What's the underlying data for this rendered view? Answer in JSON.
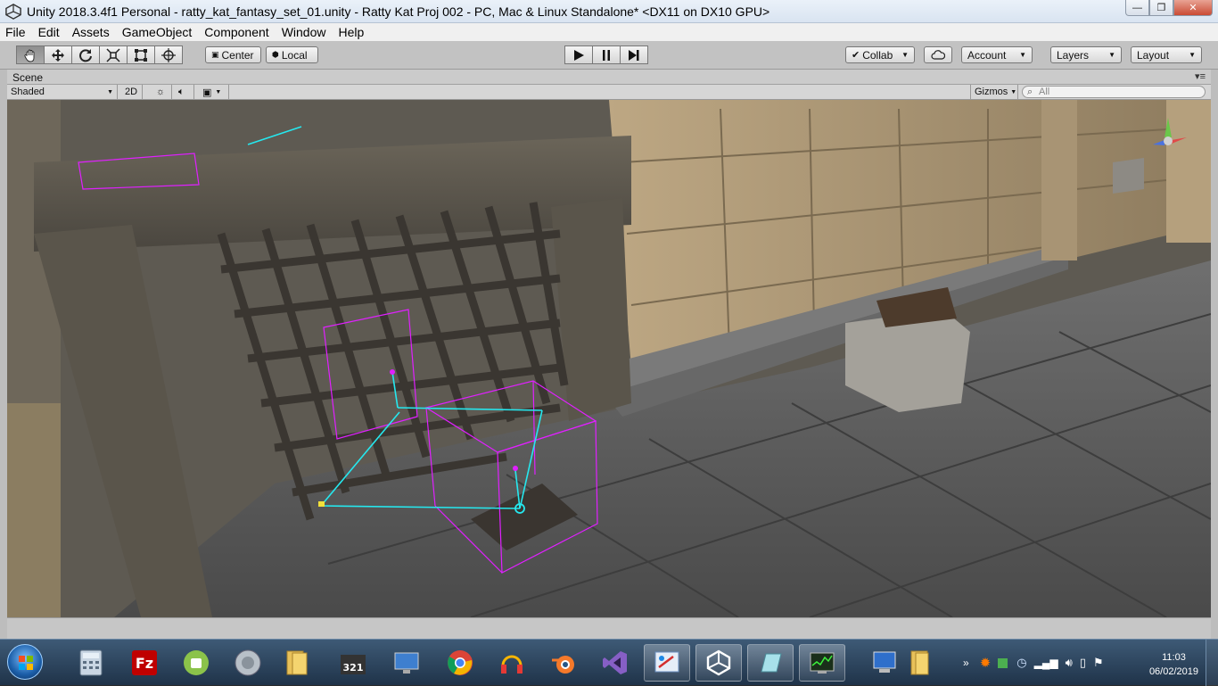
{
  "window": {
    "title": "Unity 2018.3.4f1 Personal - ratty_kat_fantasy_set_01.unity - Ratty Kat Proj 002 - PC, Mac & Linux Standalone* <DX11 on DX10 GPU>"
  },
  "menu": [
    "File",
    "Edit",
    "Assets",
    "GameObject",
    "Component",
    "Window",
    "Help"
  ],
  "toolbar": {
    "tools": [
      "hand-icon",
      "move-icon",
      "rotate-icon",
      "scale-icon",
      "rect-icon",
      "transform-icon"
    ],
    "pivot_label": "Center",
    "space_label": "Local",
    "collab_label": "Collab",
    "account_label": "Account",
    "layers_label": "Layers",
    "layout_label": "Layout"
  },
  "scene": {
    "tab_label": "Scene",
    "shading_mode": "Shaded",
    "mode_2d": "2D",
    "gizmos_label": "Gizmos",
    "search_placeholder": "All"
  },
  "taskbar": {
    "apps": [
      "calculator-icon",
      "filezilla-icon",
      "android-icon",
      "speaker-icon",
      "folder-icon",
      "video-icon",
      "monitor-icon",
      "chrome-icon",
      "headphones-icon",
      "blender-icon",
      "visual-studio-icon",
      "paint-icon",
      "unity-icon",
      "notepad-icon",
      "task-manager-icon",
      "computer-icon",
      "folder2-icon"
    ],
    "clock_time": "11:03",
    "clock_date": "06/02/2019"
  }
}
